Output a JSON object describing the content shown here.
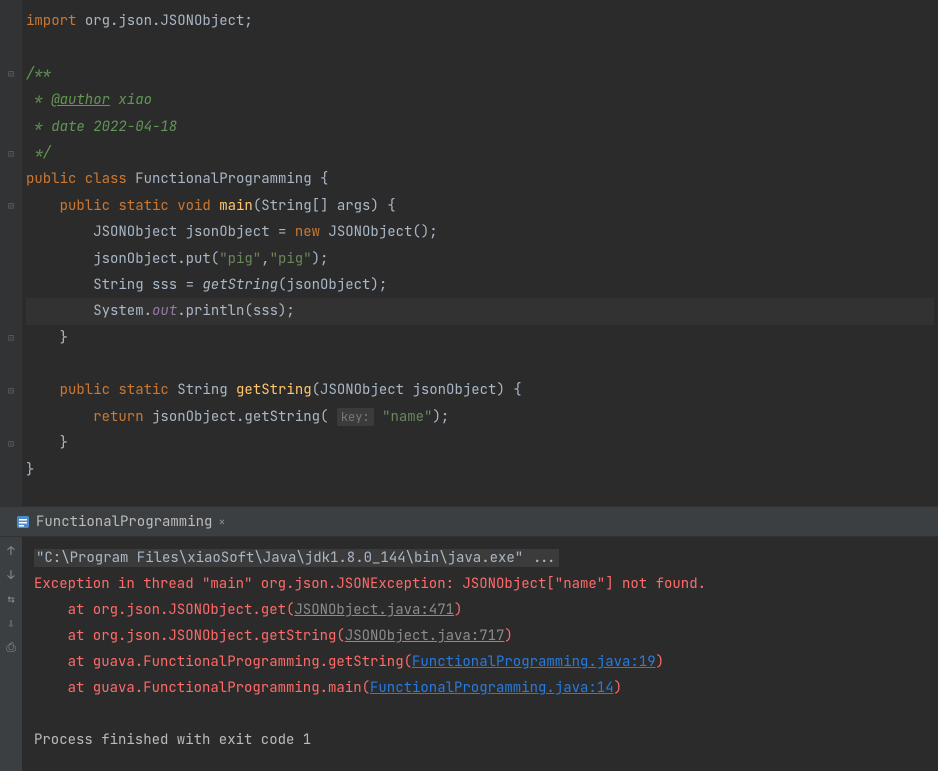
{
  "editor": {
    "lines": [
      {
        "type": "code",
        "tokens": [
          {
            "t": "import ",
            "c": "kw"
          },
          {
            "t": "org.json.JSONObject",
            "c": "cls"
          },
          {
            "t": ";",
            "c": "pn"
          }
        ]
      },
      {
        "type": "blank"
      },
      {
        "type": "code",
        "gutter": "expand",
        "tokens": [
          {
            "t": "/**",
            "c": "cmt-green"
          }
        ]
      },
      {
        "type": "code",
        "tokens": [
          {
            "t": " * ",
            "c": "cmt-green"
          },
          {
            "t": "@author",
            "c": "cmt-tag"
          },
          {
            "t": " xiao",
            "c": "cmt-green"
          }
        ]
      },
      {
        "type": "code",
        "tokens": [
          {
            "t": " * date 2022-04-18",
            "c": "cmt-green"
          }
        ]
      },
      {
        "type": "code",
        "gutter": "collapse",
        "tokens": [
          {
            "t": " */",
            "c": "cmt-green"
          }
        ]
      },
      {
        "type": "code",
        "tokens": [
          {
            "t": "public class ",
            "c": "kw"
          },
          {
            "t": "FunctionalProgramming ",
            "c": "cls"
          },
          {
            "t": "{",
            "c": "brace"
          }
        ]
      },
      {
        "type": "code",
        "gutter": "expand",
        "indent": 1,
        "tokens": [
          {
            "t": "public static void ",
            "c": "kw"
          },
          {
            "t": "main",
            "c": "fn"
          },
          {
            "t": "(",
            "c": "pn"
          },
          {
            "t": "String",
            "c": "cls"
          },
          {
            "t": "[] ",
            "c": "pn"
          },
          {
            "t": "args",
            "c": "cls"
          },
          {
            "t": ") {",
            "c": "pn"
          }
        ]
      },
      {
        "type": "code",
        "indent": 2,
        "tokens": [
          {
            "t": "JSONObject jsonObject = ",
            "c": "cls"
          },
          {
            "t": "new ",
            "c": "kw"
          },
          {
            "t": "JSONObject",
            "c": "cls"
          },
          {
            "t": "();",
            "c": "pn"
          }
        ]
      },
      {
        "type": "code",
        "indent": 2,
        "tokens": [
          {
            "t": "jsonObject.put(",
            "c": "cls"
          },
          {
            "t": "\"pig\"",
            "c": "str"
          },
          {
            "t": ",",
            "c": "pn"
          },
          {
            "t": "\"pig\"",
            "c": "str"
          },
          {
            "t": ");",
            "c": "pn"
          }
        ]
      },
      {
        "type": "code",
        "indent": 2,
        "tokens": [
          {
            "t": "String sss = ",
            "c": "cls"
          },
          {
            "t": "getString",
            "c": "fn-italic"
          },
          {
            "t": "(jsonObject);",
            "c": "pn"
          }
        ]
      },
      {
        "type": "code",
        "indent": 2,
        "hl": true,
        "tokens": [
          {
            "t": "System.",
            "c": "cls"
          },
          {
            "t": "out",
            "c": "field"
          },
          {
            "t": ".println(sss);",
            "c": "cls"
          }
        ]
      },
      {
        "type": "code",
        "gutter": "collapse",
        "indent": 1,
        "tokens": [
          {
            "t": "}",
            "c": "brace"
          }
        ]
      },
      {
        "type": "blank"
      },
      {
        "type": "code",
        "gutter": "expand",
        "indent": 1,
        "tokens": [
          {
            "t": "public static ",
            "c": "kw"
          },
          {
            "t": "String ",
            "c": "cls"
          },
          {
            "t": "getString",
            "c": "fn"
          },
          {
            "t": "(",
            "c": "pn"
          },
          {
            "t": "JSONObject jsonObject",
            "c": "cls"
          },
          {
            "t": ") {",
            "c": "pn"
          }
        ]
      },
      {
        "type": "code",
        "indent": 2,
        "tokens": [
          {
            "t": "return ",
            "c": "kw"
          },
          {
            "t": "jsonObject.getString( ",
            "c": "cls"
          },
          {
            "t": "key:",
            "c": "param-hint"
          },
          {
            "t": " ",
            "c": "cls"
          },
          {
            "t": "\"name\"",
            "c": "str"
          },
          {
            "t": ");",
            "c": "pn"
          }
        ]
      },
      {
        "type": "code",
        "gutter": "collapse",
        "indent": 1,
        "tokens": [
          {
            "t": "}",
            "c": "brace"
          }
        ]
      },
      {
        "type": "code",
        "tokens": [
          {
            "t": "}",
            "c": "brace"
          }
        ]
      }
    ]
  },
  "console": {
    "tab": {
      "label": "FunctionalProgramming"
    },
    "lines": [
      {
        "segs": [
          {
            "t": "\"C:\\Program Files\\xiaoSoft\\Java\\jdk1.8.0_144\\bin\\java.exe\" ...",
            "c": "cmd-line"
          }
        ]
      },
      {
        "segs": [
          {
            "t": "Exception in thread \"main\" org.json.JSONException: JSONObject[\"name\"] not found.",
            "c": "err"
          }
        ]
      },
      {
        "segs": [
          {
            "t": "    at org.json.JSONObject.get(",
            "c": "err"
          },
          {
            "t": "JSONObject.java:471",
            "c": "err-link-gray"
          },
          {
            "t": ")",
            "c": "err"
          }
        ]
      },
      {
        "segs": [
          {
            "t": "    at org.json.JSONObject.getString(",
            "c": "err"
          },
          {
            "t": "JSONObject.java:717",
            "c": "err-link-gray"
          },
          {
            "t": ")",
            "c": "err"
          }
        ]
      },
      {
        "segs": [
          {
            "t": "    at guava.FunctionalProgramming.getString(",
            "c": "err"
          },
          {
            "t": "FunctionalProgramming.java:19",
            "c": "err-link-blue"
          },
          {
            "t": ")",
            "c": "err"
          }
        ]
      },
      {
        "segs": [
          {
            "t": "    at guava.FunctionalProgramming.main(",
            "c": "err"
          },
          {
            "t": "FunctionalProgramming.java:14",
            "c": "err-link-blue"
          },
          {
            "t": ")",
            "c": "err"
          }
        ]
      },
      {
        "segs": [
          {
            "t": "",
            "c": "plain"
          }
        ]
      },
      {
        "segs": [
          {
            "t": "Process finished with exit code 1",
            "c": "plain"
          }
        ]
      }
    ]
  }
}
